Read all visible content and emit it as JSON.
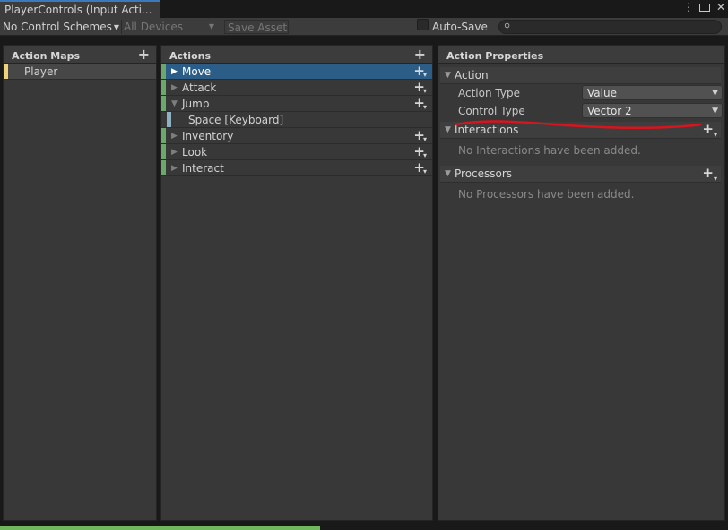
{
  "window": {
    "tab_title": "PlayerControls (Input Acti...",
    "menu_icon": "⋮",
    "close_icon": "✕"
  },
  "toolbar": {
    "control_schemes": "No Control Schemes",
    "devices": "All Devices",
    "save_asset": "Save Asset",
    "auto_save_label": "Auto-Save",
    "auto_save_checked": false,
    "search_icon": "⚲",
    "search_value": ""
  },
  "action_maps": {
    "header": "Action Maps",
    "add_icon": "+",
    "items": [
      {
        "label": "Player",
        "color": "#f0d379"
      }
    ]
  },
  "actions": {
    "header": "Actions",
    "add_icon": "+",
    "items": [
      {
        "label": "Move",
        "expanded": false,
        "selected": true,
        "color": "#6ca86c"
      },
      {
        "label": "Attack",
        "expanded": false,
        "selected": false,
        "color": "#6ca86c"
      },
      {
        "label": "Jump",
        "expanded": true,
        "selected": false,
        "color": "#6ca86c",
        "bindings": [
          {
            "label": "Space [Keyboard]"
          }
        ]
      },
      {
        "label": "Inventory",
        "expanded": false,
        "selected": false,
        "color": "#6ca86c"
      },
      {
        "label": "Look",
        "expanded": false,
        "selected": false,
        "color": "#6ca86c"
      },
      {
        "label": "Interact",
        "expanded": false,
        "selected": false,
        "color": "#6ca86c"
      }
    ]
  },
  "properties": {
    "header": "Action Properties",
    "action_section": {
      "title": "Action",
      "fields": [
        {
          "label": "Action Type",
          "value": "Value"
        },
        {
          "label": "Control Type",
          "value": "Vector 2"
        }
      ]
    },
    "interactions": {
      "title": "Interactions",
      "empty": "No Interactions have been added."
    },
    "processors": {
      "title": "Processors",
      "empty": "No Processors have been added."
    }
  },
  "colors": {
    "selection": "#2c5d87",
    "annotation": "#d8141e",
    "progress": "#6fb85b"
  }
}
